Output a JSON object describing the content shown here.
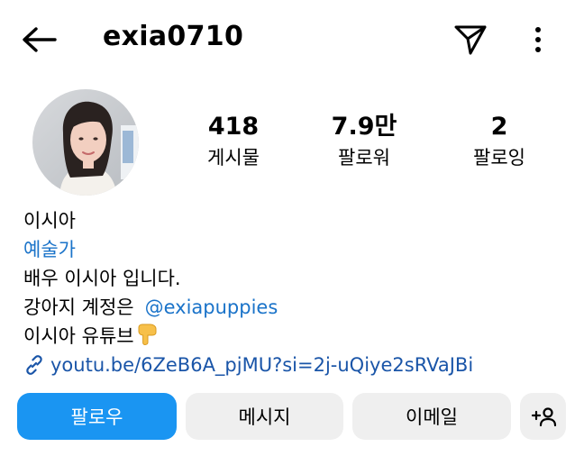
{
  "header": {
    "username": "exia0710",
    "back_icon": "arrow-left-icon",
    "dm_icon": "paper-plane-icon",
    "more_icon": "vertical-dots-icon"
  },
  "stats": {
    "posts": {
      "count": "418",
      "label": "게시물"
    },
    "followers": {
      "count": "7.9만",
      "label": "팔로워"
    },
    "following": {
      "count": "2",
      "label": "팔로잉"
    }
  },
  "bio": {
    "name": "이시아",
    "category": "예술가",
    "line1": "배우 이시아 입니다.",
    "line2_prefix": "강아지 계정은",
    "mention": "@exiapuppies",
    "line3": "이시아 유튜브",
    "emoji": "👇",
    "link": "youtu.be/6ZeB6A_pjMU?si=2j-uQiye2sRVaJBi"
  },
  "actions": {
    "follow": "팔로우",
    "message": "메시지",
    "email": "이메일",
    "add_user_icon": "add-user-icon"
  },
  "colors": {
    "follow_button": "#1a95f2",
    "link_blue": "#1a73c9",
    "secondary_button": "#efefef"
  }
}
